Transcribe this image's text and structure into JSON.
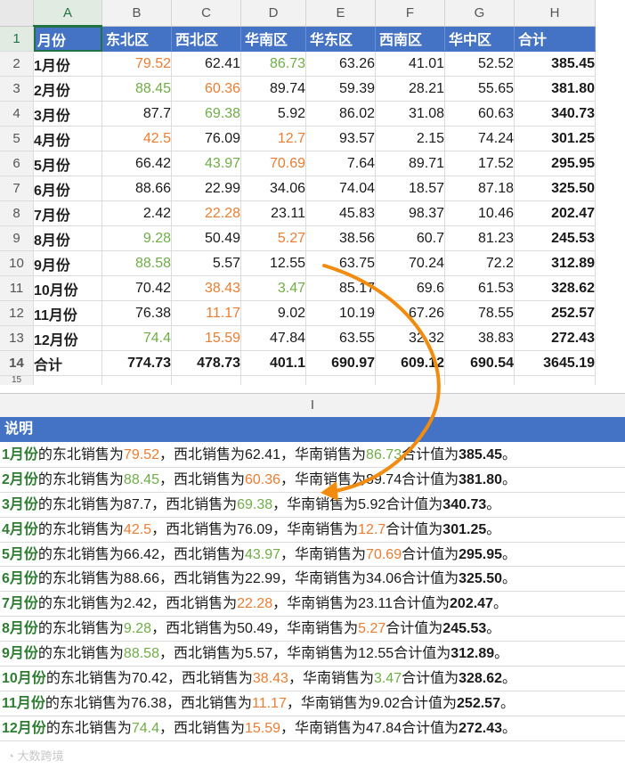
{
  "columns": [
    "A",
    "B",
    "C",
    "D",
    "E",
    "F",
    "G",
    "H"
  ],
  "rows": [
    {
      "no": "1",
      "cells": [
        "月份",
        "东北区",
        "西北区",
        "华南区",
        "华东区",
        "西南区",
        "华中区",
        "合计"
      ]
    },
    {
      "no": "2",
      "cells": [
        "1月份",
        "79.52",
        "62.41",
        "86.73",
        "63.26",
        "41.01",
        "52.52",
        "385.45"
      ]
    },
    {
      "no": "3",
      "cells": [
        "2月份",
        "88.45",
        "60.36",
        "89.74",
        "59.39",
        "28.21",
        "55.65",
        "381.80"
      ]
    },
    {
      "no": "4",
      "cells": [
        "3月份",
        "87.7",
        "69.38",
        "5.92",
        "86.02",
        "31.08",
        "60.63",
        "340.73"
      ]
    },
    {
      "no": "5",
      "cells": [
        "4月份",
        "42.5",
        "76.09",
        "12.7",
        "93.57",
        "2.15",
        "74.24",
        "301.25"
      ]
    },
    {
      "no": "6",
      "cells": [
        "5月份",
        "66.42",
        "43.97",
        "70.69",
        "7.64",
        "89.71",
        "17.52",
        "295.95"
      ]
    },
    {
      "no": "7",
      "cells": [
        "6月份",
        "88.66",
        "22.99",
        "34.06",
        "74.04",
        "18.57",
        "87.18",
        "325.50"
      ]
    },
    {
      "no": "8",
      "cells": [
        "7月份",
        "2.42",
        "22.28",
        "23.11",
        "45.83",
        "98.37",
        "10.46",
        "202.47"
      ]
    },
    {
      "no": "9",
      "cells": [
        "8月份",
        "9.28",
        "50.49",
        "5.27",
        "38.56",
        "60.7",
        "81.23",
        "245.53"
      ]
    },
    {
      "no": "10",
      "cells": [
        "9月份",
        "88.58",
        "5.57",
        "12.55",
        "63.75",
        "70.24",
        "72.2",
        "312.89"
      ]
    },
    {
      "no": "11",
      "cells": [
        "10月份",
        "70.42",
        "38.43",
        "3.47",
        "85.17",
        "69.6",
        "61.53",
        "328.62"
      ]
    },
    {
      "no": "12",
      "cells": [
        "11月份",
        "76.38",
        "11.17",
        "9.02",
        "10.19",
        "67.26",
        "78.55",
        "252.57"
      ]
    },
    {
      "no": "13",
      "cells": [
        "12月份",
        "74.4",
        "15.59",
        "47.84",
        "63.55",
        "32.32",
        "38.83",
        "272.43"
      ]
    },
    {
      "no": "14",
      "cells": [
        "合计",
        "774.73",
        "478.73",
        "401.1",
        "690.97",
        "609.12",
        "690.54",
        "3645.19"
      ]
    }
  ],
  "next_row_no": "15",
  "color_map": {
    "orange": "#ed7d31",
    "green": "#70ad47",
    "header_blue": "#4472c4",
    "month_green": "#2e7d32",
    "arrow": "#f28c0f"
  },
  "cell_colors": {
    "2": [
      "",
      "o",
      "",
      "g",
      "",
      "",
      "",
      ""
    ],
    "3": [
      "",
      "g",
      "o",
      "",
      "",
      "",
      "",
      ""
    ],
    "4": [
      "",
      "",
      "g",
      "",
      "",
      "",
      "",
      ""
    ],
    "5": [
      "",
      "o",
      "",
      "o",
      "",
      "",
      "",
      ""
    ],
    "6": [
      "",
      "",
      "g",
      "o",
      "",
      "",
      "",
      ""
    ],
    "7": [
      "",
      "",
      "",
      "",
      "",
      "",
      "",
      ""
    ],
    "8": [
      "",
      "",
      "o",
      "",
      "",
      "",
      "",
      ""
    ],
    "9": [
      "",
      "g",
      "",
      "o",
      "",
      "",
      "",
      ""
    ],
    "10": [
      "",
      "g",
      "",
      "",
      "",
      "",
      "",
      ""
    ],
    "11": [
      "",
      "",
      "o",
      "g",
      "",
      "",
      "",
      ""
    ],
    "12": [
      "",
      "",
      "o",
      "",
      "",
      "",
      "",
      ""
    ],
    "13": [
      "",
      "g",
      "o",
      "",
      "",
      "",
      "",
      ""
    ]
  },
  "col_i_label": "I",
  "notes_header": "说明",
  "notes_text": {
    "p1": "的东北销售为",
    "p2": "，西北销售为",
    "p3": "，华南销售为",
    "p4": "合计值为",
    "end": "。"
  },
  "notes": [
    {
      "month": "1月份",
      "ne": "79.52",
      "ne_c": "o",
      "nw": "62.41",
      "nw_c": "",
      "sc": "86.73",
      "sc_c": "g",
      "total": "385.45"
    },
    {
      "month": "2月份",
      "ne": "88.45",
      "ne_c": "g",
      "nw": "60.36",
      "nw_c": "o",
      "sc": "89.74",
      "sc_c": "",
      "total": "381.80"
    },
    {
      "month": "3月份",
      "ne": "87.7",
      "ne_c": "",
      "nw": "69.38",
      "nw_c": "g",
      "sc": "5.92",
      "sc_c": "",
      "total": "340.73"
    },
    {
      "month": "4月份",
      "ne": "42.5",
      "ne_c": "o",
      "nw": "76.09",
      "nw_c": "",
      "sc": "12.7",
      "sc_c": "o",
      "total": "301.25"
    },
    {
      "month": "5月份",
      "ne": "66.42",
      "ne_c": "",
      "nw": "43.97",
      "nw_c": "g",
      "sc": "70.69",
      "sc_c": "o",
      "total": "295.95"
    },
    {
      "month": "6月份",
      "ne": "88.66",
      "ne_c": "",
      "nw": "22.99",
      "nw_c": "",
      "sc": "34.06",
      "sc_c": "",
      "total": "325.50"
    },
    {
      "month": "7月份",
      "ne": "2.42",
      "ne_c": "",
      "nw": "22.28",
      "nw_c": "o",
      "sc": "23.11",
      "sc_c": "",
      "total": "202.47"
    },
    {
      "month": "8月份",
      "ne": "9.28",
      "ne_c": "g",
      "nw": "50.49",
      "nw_c": "",
      "sc": "5.27",
      "sc_c": "o",
      "total": "245.53"
    },
    {
      "month": "9月份",
      "ne": "88.58",
      "ne_c": "g",
      "nw": "5.57",
      "nw_c": "",
      "sc": "12.55",
      "sc_c": "",
      "total": "312.89"
    },
    {
      "month": "10月份",
      "ne": "70.42",
      "ne_c": "",
      "nw": "38.43",
      "nw_c": "o",
      "sc": "3.47",
      "sc_c": "g",
      "total": "328.62"
    },
    {
      "month": "11月份",
      "ne": "76.38",
      "ne_c": "",
      "nw": "11.17",
      "nw_c": "o",
      "sc": "9.02",
      "sc_c": "",
      "total": "252.57"
    },
    {
      "month": "12月份",
      "ne": "74.4",
      "ne_c": "g",
      "nw": "15.59",
      "nw_c": "o",
      "sc": "47.84",
      "sc_c": "",
      "total": "272.43"
    }
  ],
  "watermark": "大数跨境",
  "icons": {
    "arrow": "curved-arrow-icon",
    "watermark_logo": "wechat-logo-icon"
  }
}
